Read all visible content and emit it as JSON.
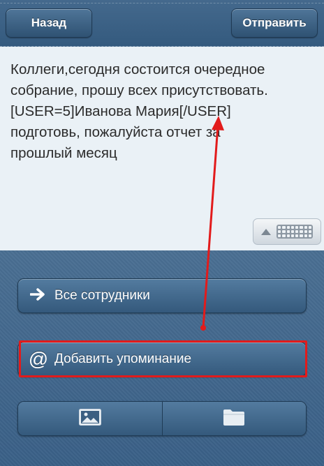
{
  "header": {
    "back_label": "Назад",
    "send_label": "Отправить"
  },
  "message": {
    "text": "Коллеги,сегодня состоится очередное\nсобрание, прошу всех присутствовать.\n[USER=5]Иванова Мария[/USER]\nподготовь, пожалуйста отчет за\nпрошлый месяц"
  },
  "actions": {
    "all_employees_label": "Все сотрудники",
    "add_mention_label": "Добавить упоминание"
  },
  "icons": {
    "arrow": "arrow-right-icon",
    "mention": "at-sign-icon",
    "image": "image-icon",
    "folder": "folder-icon",
    "keyboard": "keyboard-icon"
  },
  "colors": {
    "annotation": "#e21b1b"
  }
}
